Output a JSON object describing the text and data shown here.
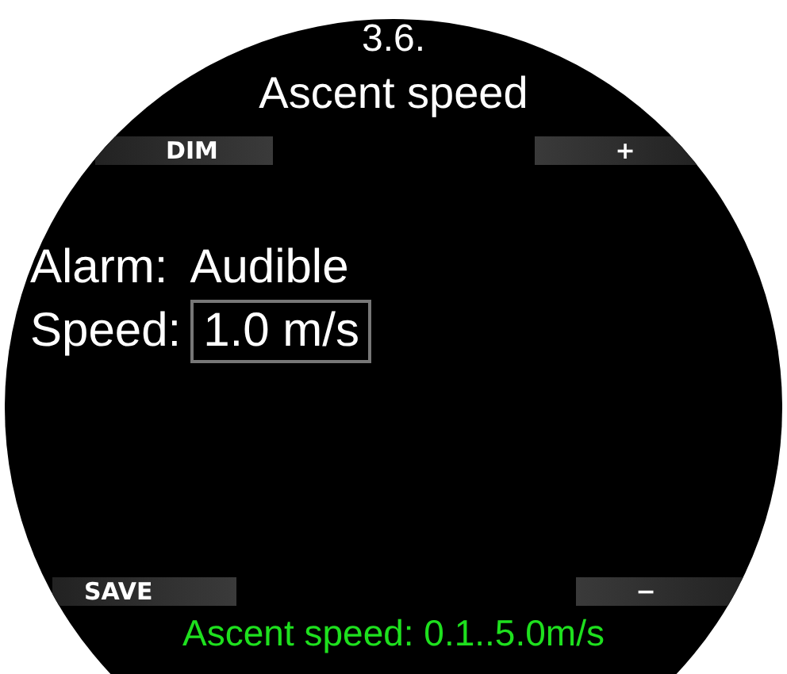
{
  "screen": {
    "number": "3.6.",
    "title": "Ascent speed"
  },
  "top_buttons": [
    {
      "label": "DIM"
    },
    {
      "label": "+"
    }
  ],
  "fields": [
    {
      "label": "Alarm:",
      "value": "Audible",
      "selected": false
    },
    {
      "label": "Speed:",
      "value": "1.0 m/s",
      "selected": true
    }
  ],
  "bottom_buttons": [
    {
      "label": "SAVE"
    },
    {
      "label": "−"
    }
  ],
  "hint": "Ascent speed: 0.1..5.0m/s"
}
